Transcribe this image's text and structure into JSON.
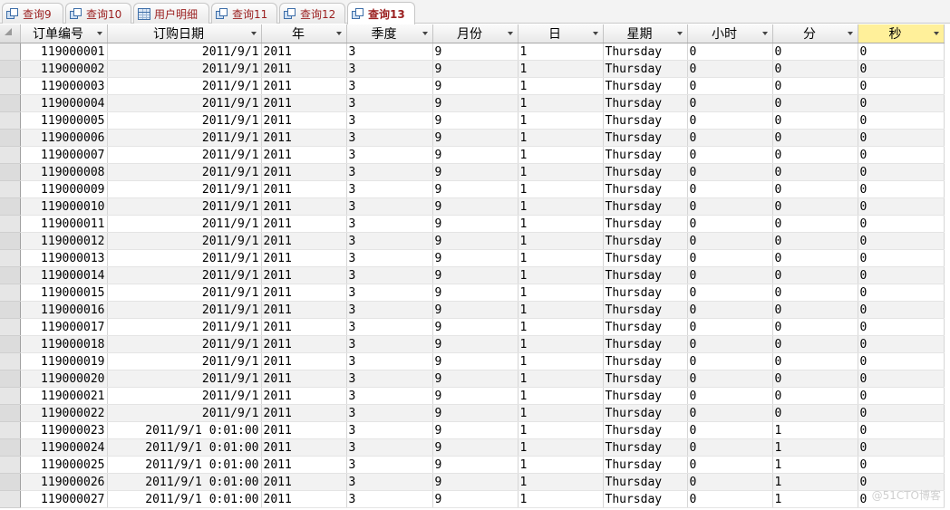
{
  "tabs": [
    {
      "label": "查询9",
      "icon": "query-icon",
      "active": false
    },
    {
      "label": "查询10",
      "icon": "query-icon",
      "active": false
    },
    {
      "label": "用户明细",
      "icon": "table-icon",
      "active": false
    },
    {
      "label": "查询11",
      "icon": "query-icon",
      "active": false
    },
    {
      "label": "查询12",
      "icon": "query-icon",
      "active": false
    },
    {
      "label": "查询13",
      "icon": "query-icon",
      "active": true
    }
  ],
  "columns": [
    "订单编号",
    "订购日期",
    "年",
    "季度",
    "月份",
    "日",
    "星期",
    "小时",
    "分",
    "秒"
  ],
  "selected_column": "秒",
  "rows": [
    [
      "119000001",
      "2011/9/1",
      "2011",
      "3",
      "9",
      "1",
      "Thursday",
      "0",
      "0",
      "0"
    ],
    [
      "119000002",
      "2011/9/1",
      "2011",
      "3",
      "9",
      "1",
      "Thursday",
      "0",
      "0",
      "0"
    ],
    [
      "119000003",
      "2011/9/1",
      "2011",
      "3",
      "9",
      "1",
      "Thursday",
      "0",
      "0",
      "0"
    ],
    [
      "119000004",
      "2011/9/1",
      "2011",
      "3",
      "9",
      "1",
      "Thursday",
      "0",
      "0",
      "0"
    ],
    [
      "119000005",
      "2011/9/1",
      "2011",
      "3",
      "9",
      "1",
      "Thursday",
      "0",
      "0",
      "0"
    ],
    [
      "119000006",
      "2011/9/1",
      "2011",
      "3",
      "9",
      "1",
      "Thursday",
      "0",
      "0",
      "0"
    ],
    [
      "119000007",
      "2011/9/1",
      "2011",
      "3",
      "9",
      "1",
      "Thursday",
      "0",
      "0",
      "0"
    ],
    [
      "119000008",
      "2011/9/1",
      "2011",
      "3",
      "9",
      "1",
      "Thursday",
      "0",
      "0",
      "0"
    ],
    [
      "119000009",
      "2011/9/1",
      "2011",
      "3",
      "9",
      "1",
      "Thursday",
      "0",
      "0",
      "0"
    ],
    [
      "119000010",
      "2011/9/1",
      "2011",
      "3",
      "9",
      "1",
      "Thursday",
      "0",
      "0",
      "0"
    ],
    [
      "119000011",
      "2011/9/1",
      "2011",
      "3",
      "9",
      "1",
      "Thursday",
      "0",
      "0",
      "0"
    ],
    [
      "119000012",
      "2011/9/1",
      "2011",
      "3",
      "9",
      "1",
      "Thursday",
      "0",
      "0",
      "0"
    ],
    [
      "119000013",
      "2011/9/1",
      "2011",
      "3",
      "9",
      "1",
      "Thursday",
      "0",
      "0",
      "0"
    ],
    [
      "119000014",
      "2011/9/1",
      "2011",
      "3",
      "9",
      "1",
      "Thursday",
      "0",
      "0",
      "0"
    ],
    [
      "119000015",
      "2011/9/1",
      "2011",
      "3",
      "9",
      "1",
      "Thursday",
      "0",
      "0",
      "0"
    ],
    [
      "119000016",
      "2011/9/1",
      "2011",
      "3",
      "9",
      "1",
      "Thursday",
      "0",
      "0",
      "0"
    ],
    [
      "119000017",
      "2011/9/1",
      "2011",
      "3",
      "9",
      "1",
      "Thursday",
      "0",
      "0",
      "0"
    ],
    [
      "119000018",
      "2011/9/1",
      "2011",
      "3",
      "9",
      "1",
      "Thursday",
      "0",
      "0",
      "0"
    ],
    [
      "119000019",
      "2011/9/1",
      "2011",
      "3",
      "9",
      "1",
      "Thursday",
      "0",
      "0",
      "0"
    ],
    [
      "119000020",
      "2011/9/1",
      "2011",
      "3",
      "9",
      "1",
      "Thursday",
      "0",
      "0",
      "0"
    ],
    [
      "119000021",
      "2011/9/1",
      "2011",
      "3",
      "9",
      "1",
      "Thursday",
      "0",
      "0",
      "0"
    ],
    [
      "119000022",
      "2011/9/1",
      "2011",
      "3",
      "9",
      "1",
      "Thursday",
      "0",
      "0",
      "0"
    ],
    [
      "119000023",
      "2011/9/1  0:01:00",
      "2011",
      "3",
      "9",
      "1",
      "Thursday",
      "0",
      "1",
      "0"
    ],
    [
      "119000024",
      "2011/9/1  0:01:00",
      "2011",
      "3",
      "9",
      "1",
      "Thursday",
      "0",
      "1",
      "0"
    ],
    [
      "119000025",
      "2011/9/1  0:01:00",
      "2011",
      "3",
      "9",
      "1",
      "Thursday",
      "0",
      "1",
      "0"
    ],
    [
      "119000026",
      "2011/9/1  0:01:00",
      "2011",
      "3",
      "9",
      "1",
      "Thursday",
      "0",
      "1",
      "0"
    ],
    [
      "119000027",
      "2011/9/1  0:01:00",
      "2011",
      "3",
      "9",
      "1",
      "Thursday",
      "0",
      "1",
      "0"
    ]
  ],
  "watermark": "@51CTO博客"
}
